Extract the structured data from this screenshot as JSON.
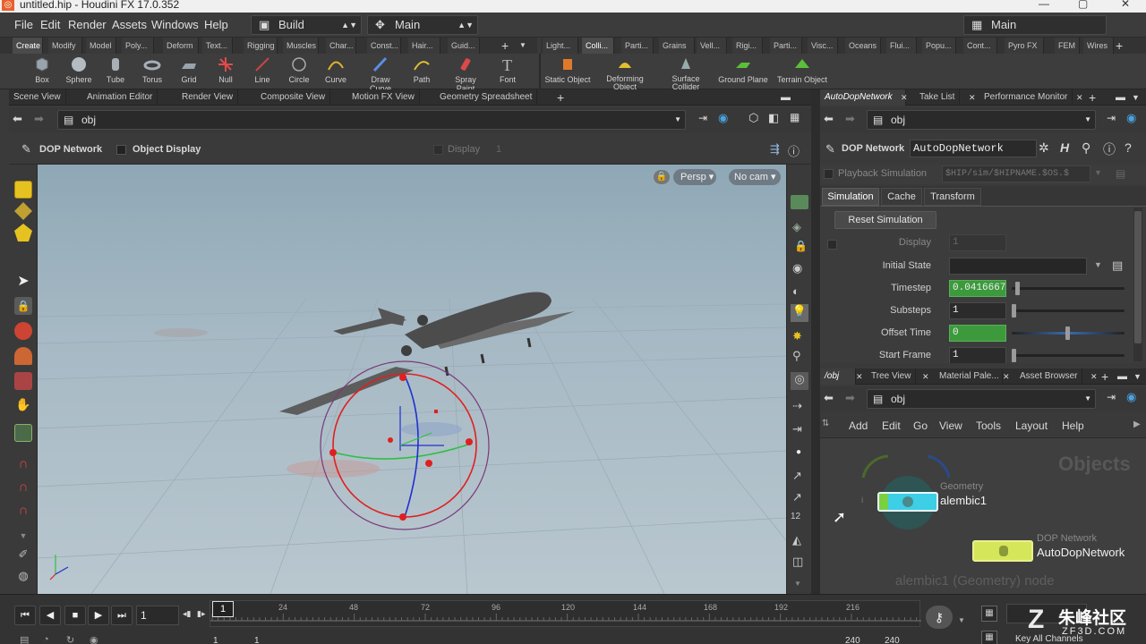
{
  "window": {
    "title": "untitled.hip - Houdini FX 17.0.352"
  },
  "menu": {
    "items": [
      "File",
      "Edit",
      "Render",
      "Assets",
      "Windows",
      "Help"
    ],
    "desktop_build": "Build",
    "desktop_main": "Main",
    "right_desktop": "Main"
  },
  "shelf_tabs_left": [
    "Create",
    "Modify",
    "Model",
    "Poly...",
    "Deform",
    "Text...",
    "Rigging",
    "Muscles",
    "Char...",
    "Const...",
    "Hair...",
    "Guid..."
  ],
  "shelf_tabs_right": [
    "Light...",
    "Colli...",
    "Parti...",
    "Grains",
    "Vell...",
    "Rigi...",
    "Parti...",
    "Visc...",
    "Oceans",
    "Flui...",
    "Popu...",
    "Cont...",
    "Pyro FX",
    "FEM",
    "Wires"
  ],
  "tools_left": [
    "Box",
    "Sphere",
    "Tube",
    "Torus",
    "Grid",
    "Null",
    "Line",
    "Circle",
    "Curve",
    "Draw Curve",
    "Path",
    "Spray Paint",
    "Font"
  ],
  "tools_right": [
    "Static Object",
    "Deforming Object",
    "Surface Collider",
    "Ground Plane",
    "Terrain Object"
  ],
  "scene_tabs": [
    "Scene View",
    "Animation Editor",
    "Render View",
    "Composite View",
    "Motion FX View",
    "Geometry Spreadsheet"
  ],
  "scene_path": "obj",
  "viewer": {
    "node_type": "DOP Network",
    "object_display": "Object Display",
    "display": "Display",
    "display_value": "1",
    "persp": "Persp",
    "camera": "No cam"
  },
  "param_tabs": [
    "AutoDopNetwork",
    "Take List",
    "Performance Monitor"
  ],
  "param_path": "obj",
  "params": {
    "node_type": "DOP Network",
    "node_name": "AutoDopNetwork",
    "playback_label": "Playback Simulation",
    "playback_path": "$HIP/sim/$HIPNAME.$OS.$",
    "tabs": [
      "Simulation",
      "Cache",
      "Transform"
    ],
    "reset_label": "Reset Simulation",
    "rows": [
      {
        "label": "Display",
        "value": "1"
      },
      {
        "label": "Initial State",
        "value": ""
      },
      {
        "label": "Timestep",
        "value": "0.0416667"
      },
      {
        "label": "Substeps",
        "value": "1"
      },
      {
        "label": "Offset Time",
        "value": "0"
      },
      {
        "label": "Start Frame",
        "value": "1"
      }
    ]
  },
  "net_tabs": [
    "/obj",
    "Tree View",
    "Material Pale...",
    "Asset Browser"
  ],
  "net_path": "obj",
  "net_menu": [
    "Add",
    "Edit",
    "Go",
    "View",
    "Tools",
    "Layout",
    "Help"
  ],
  "net": {
    "context_label": "Objects",
    "node1_type": "Geometry",
    "node1_name": "alembic1",
    "node2_type": "DOP Network",
    "node2_name": "AutoDopNetwork",
    "status": "alembic1 (Geometry) node"
  },
  "timeline": {
    "frame": "1",
    "tick_labels": [
      "24",
      "48",
      "72",
      "96",
      "120",
      "144",
      "168",
      "192",
      "216"
    ],
    "current_frame_marker": "1",
    "range_start": "1",
    "range_start2": "1",
    "range_end": "240",
    "range_end2": "240",
    "key_all_channels": "Key All Channels"
  },
  "watermark": {
    "text": "朱峰社区",
    "url": "ZF3D.COM"
  },
  "colors": {
    "accent_green": "#3c9a3c",
    "node_cyan": "#3ccfe6",
    "node_yellow": "#d6e65a",
    "logo_orange": "#e8612c"
  }
}
